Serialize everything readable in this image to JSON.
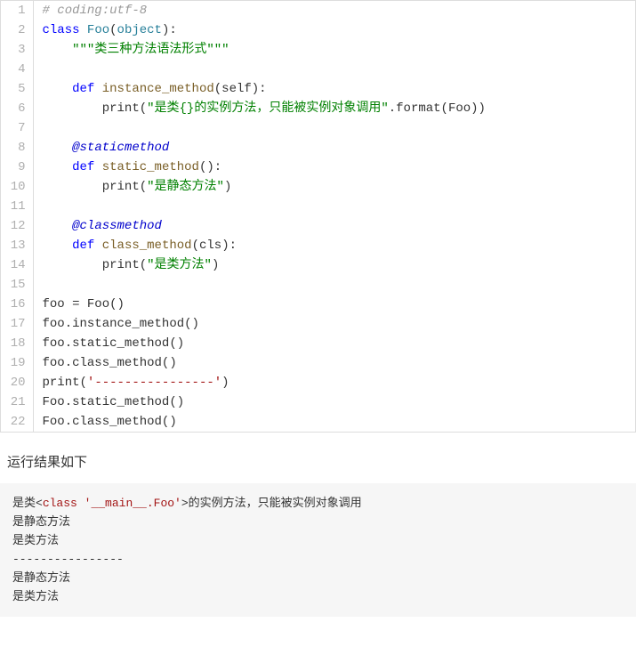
{
  "code": {
    "lines": [
      {
        "n": "1",
        "tokens": [
          {
            "c": "c-comment",
            "t": "# coding:utf-8"
          }
        ]
      },
      {
        "n": "2",
        "tokens": [
          {
            "c": "c-keyword",
            "t": "class"
          },
          {
            "t": " "
          },
          {
            "c": "c-class",
            "t": "Foo"
          },
          {
            "t": "("
          },
          {
            "c": "c-builtin",
            "t": "object"
          },
          {
            "t": "):"
          }
        ]
      },
      {
        "n": "3",
        "tokens": [
          {
            "t": "    "
          },
          {
            "c": "c-green",
            "t": "\"\"\"类三种方法语法形式\"\"\""
          }
        ]
      },
      {
        "n": "4",
        "tokens": []
      },
      {
        "n": "5",
        "tokens": [
          {
            "t": "    "
          },
          {
            "c": "c-keyword",
            "t": "def"
          },
          {
            "t": " "
          },
          {
            "c": "c-func",
            "t": "instance_method"
          },
          {
            "t": "("
          },
          {
            "c": "c-param",
            "t": "self"
          },
          {
            "t": "):"
          }
        ]
      },
      {
        "n": "6",
        "tokens": [
          {
            "t": "        print("
          },
          {
            "c": "c-green",
            "t": "\"是类{}的实例方法，只能被实例对象调用\""
          },
          {
            "t": ".format(Foo))"
          }
        ]
      },
      {
        "n": "7",
        "tokens": []
      },
      {
        "n": "8",
        "tokens": [
          {
            "t": "    "
          },
          {
            "c": "c-decorator",
            "t": "@staticmethod"
          }
        ]
      },
      {
        "n": "9",
        "tokens": [
          {
            "t": "    "
          },
          {
            "c": "c-keyword",
            "t": "def"
          },
          {
            "t": " "
          },
          {
            "c": "c-func",
            "t": "static_method"
          },
          {
            "t": "():"
          }
        ]
      },
      {
        "n": "10",
        "tokens": [
          {
            "t": "        print("
          },
          {
            "c": "c-green",
            "t": "\"是静态方法\""
          },
          {
            "t": ")"
          }
        ]
      },
      {
        "n": "11",
        "tokens": []
      },
      {
        "n": "12",
        "tokens": [
          {
            "t": "    "
          },
          {
            "c": "c-decorator",
            "t": "@classmethod"
          }
        ]
      },
      {
        "n": "13",
        "tokens": [
          {
            "t": "    "
          },
          {
            "c": "c-keyword",
            "t": "def"
          },
          {
            "t": " "
          },
          {
            "c": "c-func",
            "t": "class_method"
          },
          {
            "t": "("
          },
          {
            "c": "c-param",
            "t": "cls"
          },
          {
            "t": "):"
          }
        ]
      },
      {
        "n": "14",
        "tokens": [
          {
            "t": "        print("
          },
          {
            "c": "c-green",
            "t": "\"是类方法\""
          },
          {
            "t": ")"
          }
        ]
      },
      {
        "n": "15",
        "tokens": []
      },
      {
        "n": "16",
        "tokens": [
          {
            "t": "foo = Foo()"
          }
        ]
      },
      {
        "n": "17",
        "tokens": [
          {
            "t": "foo.instance_method()"
          }
        ]
      },
      {
        "n": "18",
        "tokens": [
          {
            "t": "foo.static_method()"
          }
        ]
      },
      {
        "n": "19",
        "tokens": [
          {
            "t": "foo.class_method()"
          }
        ]
      },
      {
        "n": "20",
        "tokens": [
          {
            "t": "print("
          },
          {
            "c": "c-string",
            "t": "'----------------'"
          },
          {
            "t": ")"
          }
        ]
      },
      {
        "n": "21",
        "tokens": [
          {
            "t": "Foo.static_method()"
          }
        ]
      },
      {
        "n": "22",
        "tokens": [
          {
            "t": "Foo.class_method()"
          }
        ]
      }
    ]
  },
  "section_label": "运行结果如下",
  "output": {
    "lines": [
      {
        "tokens": [
          {
            "t": "是类<"
          },
          {
            "c": "out-class",
            "t": "class"
          },
          {
            "t": " "
          },
          {
            "c": "out-str",
            "t": "'__main__.Foo'"
          },
          {
            "t": ">的实例方法，只能被实例对象调用"
          }
        ]
      },
      {
        "tokens": [
          {
            "t": "是静态方法"
          }
        ]
      },
      {
        "tokens": [
          {
            "t": "是类方法"
          }
        ]
      },
      {
        "tokens": [
          {
            "t": "----------------"
          }
        ]
      },
      {
        "tokens": [
          {
            "t": "是静态方法"
          }
        ]
      },
      {
        "tokens": [
          {
            "t": "是类方法"
          }
        ]
      }
    ]
  }
}
